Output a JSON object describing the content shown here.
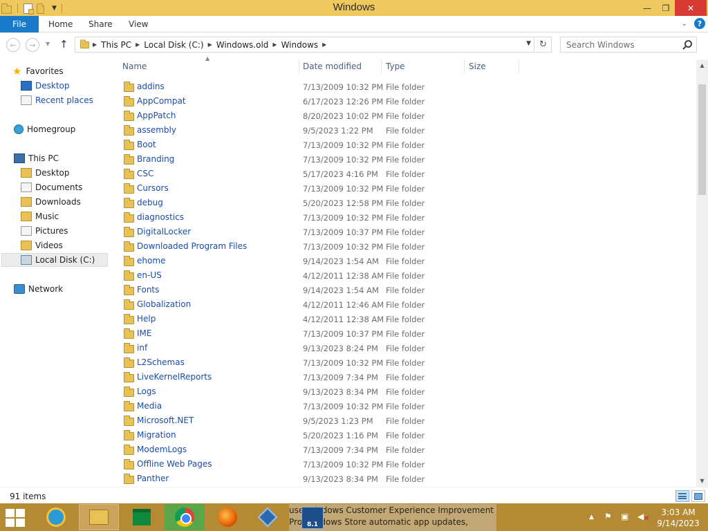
{
  "window": {
    "title": "Windows",
    "controls": {
      "minimize": "—",
      "maximize": "❐",
      "close": "✕"
    }
  },
  "ribbon": {
    "file": "File",
    "tabs": [
      "Home",
      "Share",
      "View"
    ],
    "help": "?"
  },
  "address": {
    "crumbs": [
      "This PC",
      "Local Disk (C:)",
      "Windows.old",
      "Windows"
    ]
  },
  "search": {
    "placeholder": "Search Windows"
  },
  "nav": {
    "favorites": "Favorites",
    "fav_items": [
      "Desktop",
      "Recent places"
    ],
    "homegroup": "Homegroup",
    "thispc": "This PC",
    "pc_items": [
      "Desktop",
      "Documents",
      "Downloads",
      "Music",
      "Pictures",
      "Videos",
      "Local Disk (C:)"
    ],
    "network": "Network"
  },
  "columns": {
    "name": "Name",
    "date": "Date modified",
    "type": "Type",
    "size": "Size"
  },
  "files": [
    {
      "name": "addins",
      "date": "7/13/2009 10:32 PM",
      "type": "File folder"
    },
    {
      "name": "AppCompat",
      "date": "6/17/2023 12:26 PM",
      "type": "File folder"
    },
    {
      "name": "AppPatch",
      "date": "8/20/2023 10:02 PM",
      "type": "File folder"
    },
    {
      "name": "assembly",
      "date": "9/5/2023 1:22 PM",
      "type": "File folder"
    },
    {
      "name": "Boot",
      "date": "7/13/2009 10:32 PM",
      "type": "File folder"
    },
    {
      "name": "Branding",
      "date": "7/13/2009 10:32 PM",
      "type": "File folder"
    },
    {
      "name": "CSC",
      "date": "5/17/2023 4:16 PM",
      "type": "File folder"
    },
    {
      "name": "Cursors",
      "date": "7/13/2009 10:32 PM",
      "type": "File folder"
    },
    {
      "name": "debug",
      "date": "5/20/2023 12:58 PM",
      "type": "File folder"
    },
    {
      "name": "diagnostics",
      "date": "7/13/2009 10:32 PM",
      "type": "File folder"
    },
    {
      "name": "DigitalLocker",
      "date": "7/13/2009 10:37 PM",
      "type": "File folder"
    },
    {
      "name": "Downloaded Program Files",
      "date": "7/13/2009 10:32 PM",
      "type": "File folder"
    },
    {
      "name": "ehome",
      "date": "9/14/2023 1:54 AM",
      "type": "File folder"
    },
    {
      "name": "en-US",
      "date": "4/12/2011 12:38 AM",
      "type": "File folder"
    },
    {
      "name": "Fonts",
      "date": "9/14/2023 1:54 AM",
      "type": "File folder"
    },
    {
      "name": "Globalization",
      "date": "4/12/2011 12:46 AM",
      "type": "File folder"
    },
    {
      "name": "Help",
      "date": "4/12/2011 12:38 AM",
      "type": "File folder"
    },
    {
      "name": "IME",
      "date": "7/13/2009 10:37 PM",
      "type": "File folder"
    },
    {
      "name": "inf",
      "date": "9/13/2023 8:24 PM",
      "type": "File folder"
    },
    {
      "name": "L2Schemas",
      "date": "7/13/2009 10:32 PM",
      "type": "File folder"
    },
    {
      "name": "LiveKernelReports",
      "date": "7/13/2009 7:34 PM",
      "type": "File folder"
    },
    {
      "name": "Logs",
      "date": "9/13/2023 8:34 PM",
      "type": "File folder"
    },
    {
      "name": "Media",
      "date": "7/13/2009 10:32 PM",
      "type": "File folder"
    },
    {
      "name": "Microsoft.NET",
      "date": "9/5/2023 1:23 PM",
      "type": "File folder"
    },
    {
      "name": "Migration",
      "date": "5/20/2023 1:16 PM",
      "type": "File folder"
    },
    {
      "name": "ModemLogs",
      "date": "7/13/2009 7:34 PM",
      "type": "File folder"
    },
    {
      "name": "Offline Web Pages",
      "date": "7/13/2009 10:32 PM",
      "type": "File folder"
    },
    {
      "name": "Panther",
      "date": "9/13/2023 8:34 PM",
      "type": "File folder"
    }
  ],
  "status": {
    "items": "91 items"
  },
  "taskbar": {
    "notification_lines": [
      "use Windows Customer Experience Improvement",
      "Pro Windows Store automatic app updates,"
    ],
    "notification_badge": "8.1",
    "time": "3:03 AM",
    "date": "9/14/2023"
  },
  "colors": {
    "titlebar": "#efc95e",
    "file_tab": "#1979ca",
    "link": "#1a4ca8",
    "taskbar": "#b58a35",
    "close": "#d63c34"
  }
}
